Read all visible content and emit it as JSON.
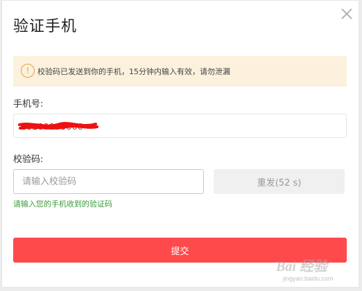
{
  "dialog": {
    "title": "验证手机",
    "close_icon": "close-icon"
  },
  "notice": {
    "icon": "info-circle-icon",
    "icon_glyph": "!",
    "text": "校验码已发送到你的手机，15分钟内输入有效，请勿泄漏",
    "background": "#fbf1dd",
    "icon_color": "#e8a23a"
  },
  "phone": {
    "label": "手机号:",
    "value": "13100000000"
  },
  "code": {
    "label": "校验码:",
    "placeholder": "请输入校验码",
    "value": "",
    "resend_label": "重发(52 s)",
    "hint": "请输入您的手机收到的验证码"
  },
  "submit": {
    "label": "提交",
    "color": "#ff4a4c"
  },
  "watermark": {
    "logo_text": "Bai 经验",
    "url": "jingyan.baidu.com"
  }
}
